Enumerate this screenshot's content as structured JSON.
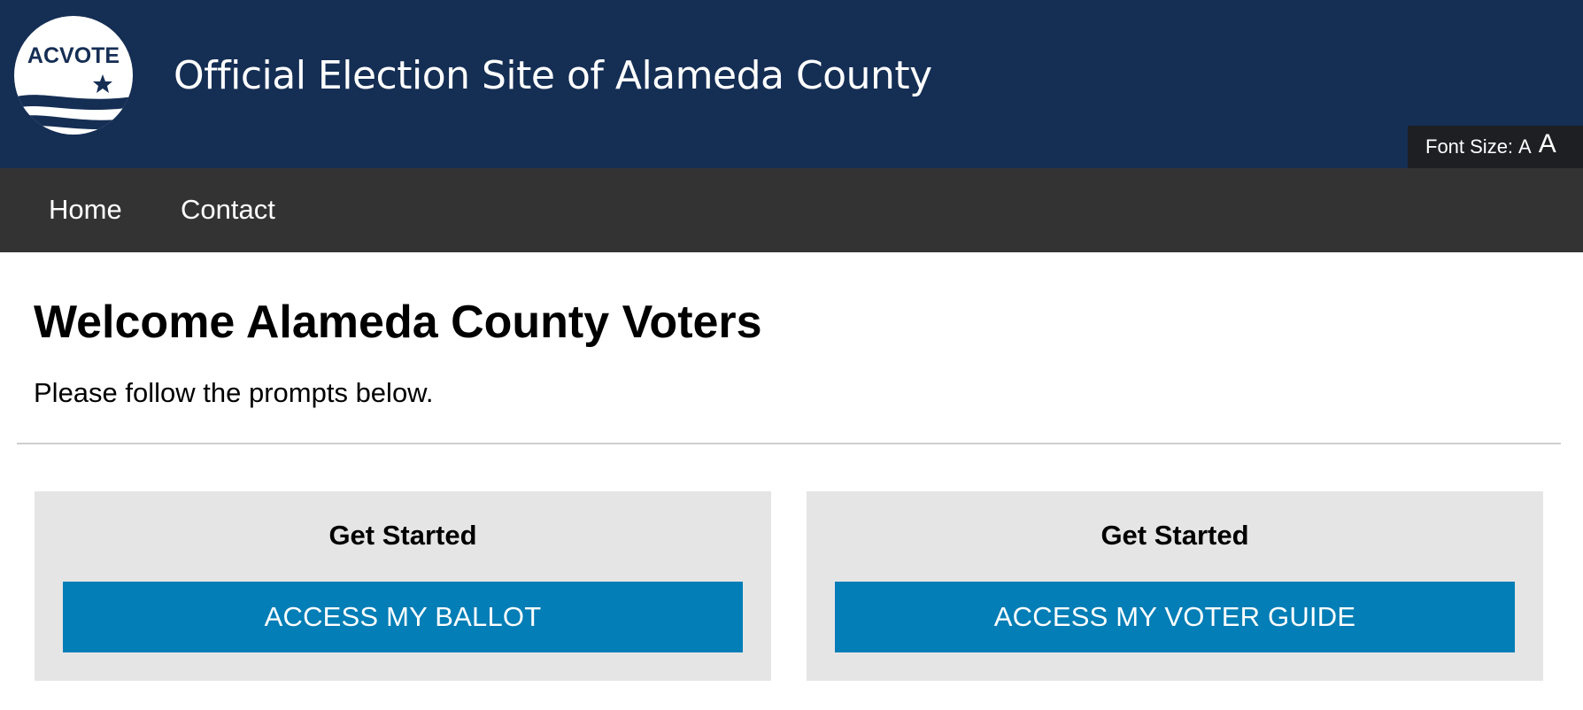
{
  "header": {
    "logo_text": "ACVOTE",
    "title": "Official Election Site of Alameda County",
    "font_size_label": "Font Size:",
    "font_size_small": "A",
    "font_size_large": "A"
  },
  "nav": {
    "items": [
      {
        "label": "Home"
      },
      {
        "label": "Contact"
      }
    ]
  },
  "main": {
    "heading": "Welcome Alameda County Voters",
    "subtitle": "Please follow the prompts below.",
    "cards": [
      {
        "heading": "Get Started",
        "button_label": "ACCESS MY BALLOT"
      },
      {
        "heading": "Get Started",
        "button_label": "ACCESS MY VOTER GUIDE"
      }
    ]
  },
  "colors": {
    "header_bg": "#152e54",
    "nav_bg": "#333333",
    "card_bg": "#e5e5e5",
    "button_bg": "#037eb6"
  },
  "icons": [
    "acvote-logo",
    "star-icon"
  ]
}
